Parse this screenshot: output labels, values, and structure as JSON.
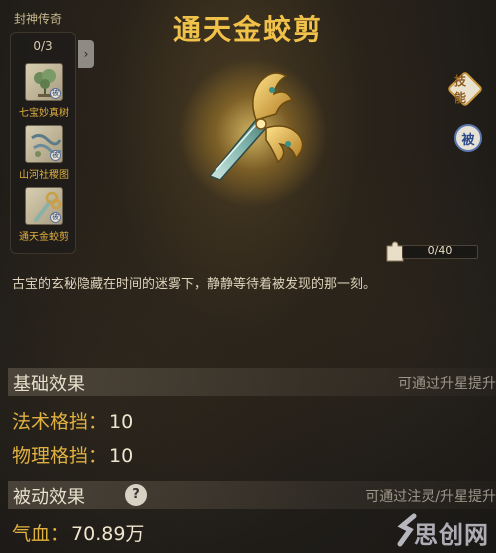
{
  "title": "通天金蛟剪",
  "collection": {
    "title": "封神传奇",
    "count": "0/3",
    "items": [
      {
        "label": "七宝妙真树",
        "badge": "被"
      },
      {
        "label": "山河社稷图",
        "badge": "被"
      },
      {
        "label": "通天金蛟剪",
        "badge": "被"
      }
    ],
    "expand_glyph": "›"
  },
  "buttons": {
    "skill_label": "技能",
    "passive_label": "被"
  },
  "progress": {
    "text": "0/40",
    "value": 0,
    "max": 40
  },
  "description": "古宝的玄秘隐藏在时间的迷雾下，静静等待着被发现的那一刻。",
  "basic_effect": {
    "title": "基础效果",
    "note": "可通过升星提升",
    "stats": [
      {
        "label": "法术格挡：",
        "value": "10"
      },
      {
        "label": "物理格挡：",
        "value": "10"
      }
    ]
  },
  "passive_effect": {
    "title": "被动效果",
    "help": "?",
    "note": "可通过注灵/升星提升",
    "stats": [
      {
        "label": "气血：",
        "value": "70.89万"
      }
    ]
  },
  "watermark": "思创网",
  "colors": {
    "gold": "#f0c24a",
    "stat_label": "#e0b040",
    "accent_bronze": "#c99a40"
  }
}
